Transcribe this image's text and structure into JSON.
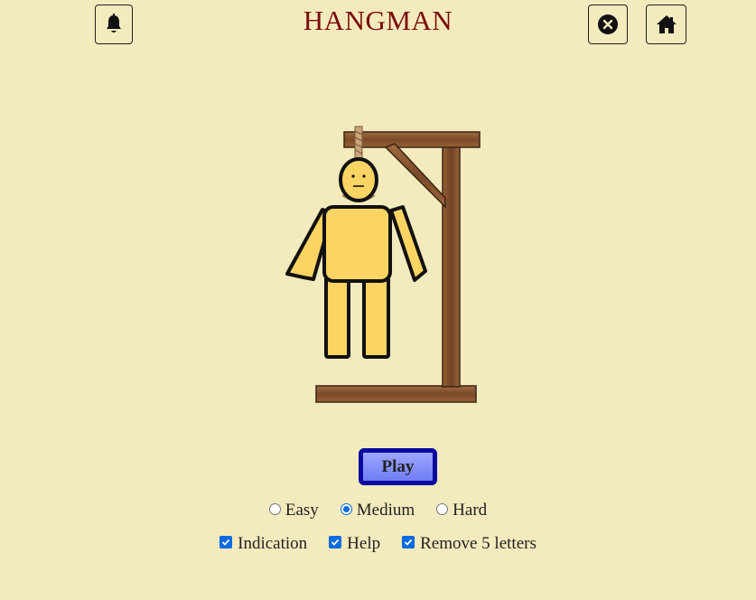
{
  "header": {
    "title": "HANGMAN",
    "title_color": "#7a0a0a",
    "left_icon": "bell-icon",
    "right_icons": [
      "close-circle-icon",
      "home-icon"
    ]
  },
  "game": {
    "play_label": "Play",
    "play_button_border": "#0a0aa0",
    "difficulty": {
      "options": [
        {
          "label": "Easy",
          "selected": false
        },
        {
          "label": "Medium",
          "selected": true
        },
        {
          "label": "Hard",
          "selected": false
        }
      ]
    },
    "settings": [
      {
        "label": "Indication",
        "checked": true
      },
      {
        "label": "Help",
        "checked": true
      },
      {
        "label": "Remove 5 letters",
        "checked": true
      }
    ]
  },
  "colors": {
    "background": "#f3eabd",
    "wood": "#8a5a35",
    "figure_fill": "#fcd463",
    "accent_blue": "#0b6be0"
  }
}
